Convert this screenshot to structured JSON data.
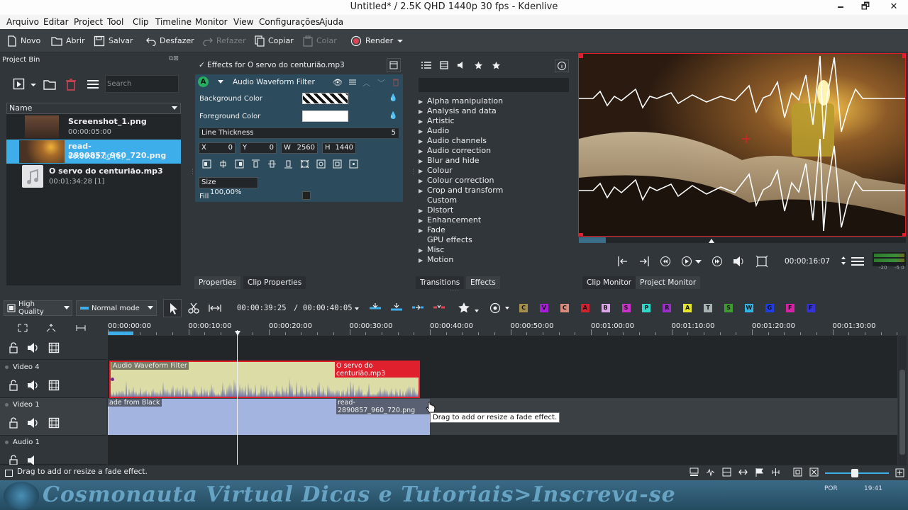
{
  "window": {
    "title": "Untitled* / 2.5K QHD 1440p 30 fps - Kdenlive",
    "minimize": "🗕",
    "maximize": "🗗",
    "close": "✕"
  },
  "menu": [
    "Arquivo",
    "Editar",
    "Project",
    "Tool",
    "Clip",
    "Timeline",
    "Monitor",
    "View",
    "Configurações",
    "Ajuda"
  ],
  "toolbar": {
    "new": "Novo",
    "open": "Abrir",
    "save": "Salvar",
    "undo": "Desfazer",
    "redo": "Refazer",
    "copy": "Copiar",
    "paste": "Colar",
    "render": "Render"
  },
  "bin": {
    "title": "Project Bin",
    "search_placeholder": "Search",
    "column_name": "Name",
    "clips": [
      {
        "name": "Screenshot_1.png",
        "duration": "00:00:05:00"
      },
      {
        "name": "read-2890857_960_720.png",
        "duration": "00:00:05:00  [1]"
      },
      {
        "name": "O servo do centurião.mp3",
        "duration": "00:01:34:28  [1]"
      }
    ]
  },
  "stack": {
    "header": "Effects for O servo do centurião.mp3",
    "effect_badge": "A",
    "effect_name": "Audio Waveform Filter",
    "bg_color_label": "Background Color",
    "fg_color_label": "Foreground Color",
    "line_thickness_label": "Line Thickness",
    "line_thickness_value": "5",
    "x_label": "X",
    "x_value": "0",
    "y_label": "Y",
    "y_value": "0",
    "w_label": "W",
    "w_value": "2560",
    "h_label": "H",
    "h_value": "1440",
    "size_label": "Size",
    "size_value": "100,00%",
    "fill_label": "Fill",
    "tab_properties": "Properties",
    "tab_clip_properties": "Clip Properties"
  },
  "effects": {
    "categories": [
      {
        "label": "Alpha manipulation",
        "arrow": true
      },
      {
        "label": "Analysis and data",
        "arrow": true
      },
      {
        "label": "Artistic",
        "arrow": true
      },
      {
        "label": "Audio",
        "arrow": true
      },
      {
        "label": "Audio channels",
        "arrow": true
      },
      {
        "label": "Audio correction",
        "arrow": true
      },
      {
        "label": "Blur and hide",
        "arrow": true
      },
      {
        "label": "Colour",
        "arrow": true
      },
      {
        "label": "Colour correction",
        "arrow": true
      },
      {
        "label": "Crop and transform",
        "arrow": true
      },
      {
        "label": "Custom",
        "arrow": false
      },
      {
        "label": "Distort",
        "arrow": true
      },
      {
        "label": "Enhancement",
        "arrow": true
      },
      {
        "label": "Fade",
        "arrow": true
      },
      {
        "label": "GPU effects",
        "arrow": false
      },
      {
        "label": "Misc",
        "arrow": true
      },
      {
        "label": "Motion",
        "arrow": true
      }
    ],
    "tab_transitions": "Transitions",
    "tab_effects": "Effects"
  },
  "monitor": {
    "timecode": "00:00:16:07",
    "tab_clip": "Clip Monitor",
    "tab_project": "Project Monitor",
    "meter_left": "-20",
    "meter_right": "-5 0"
  },
  "timeline_toolbar": {
    "quality": "High Quality",
    "mode": "Normal mode",
    "position": "00:00:39:25",
    "separator": "/",
    "duration": "00:00:40:05",
    "letters": [
      {
        "l": "C",
        "c": "#a58e4a"
      },
      {
        "l": "V",
        "c": "#a51fd6"
      },
      {
        "l": "C",
        "c": "#d88b7b"
      },
      {
        "l": "A",
        "c": "#d0232f"
      },
      {
        "l": "B",
        "c": "#d9a6e6"
      },
      {
        "l": "S",
        "c": "#c932c9"
      },
      {
        "l": "P",
        "c": "#2cd8c8"
      },
      {
        "l": "R",
        "c": "#9a2fc7"
      },
      {
        "l": "A",
        "c": "#e6e62a"
      },
      {
        "l": "T",
        "c": "#a7b2b3"
      },
      {
        "l": "S",
        "c": "#3f9a2f"
      },
      {
        "l": "W",
        "c": "#2fb6e6"
      },
      {
        "l": "G",
        "c": "#1f3ce6"
      },
      {
        "l": "F",
        "c": "#d620a8"
      },
      {
        "l": "F",
        "c": "#3431d6"
      }
    ]
  },
  "ruler": [
    "00:00:00:00",
    "00:00:10:00",
    "00:00:20:00",
    "00:00:30:00",
    "00:00:40:00",
    "00:00:50:00",
    "00:01:00:00",
    "00:01:10:00",
    "00:01:20:00",
    "00:01:30:00"
  ],
  "tracks": [
    {
      "name": "Video 4"
    },
    {
      "name": "Video 1"
    },
    {
      "name": "Audio 1"
    }
  ],
  "clips": {
    "audio_clip_effect": "Audio Waveform Filter",
    "audio_clip_name": "O servo do centurião.mp3",
    "image_clip_fade": "ade from Black",
    "image_clip_name": "read-2890857_960_720.png"
  },
  "tooltip": "Drag to add or resize a fade effect.",
  "status": "Drag to add or resize a fade effect.",
  "banner": "Cosmonauta Virtual Dicas e Tutoriais>Inscreva-se",
  "tray": {
    "lang": "POR",
    "time": "19:41"
  }
}
